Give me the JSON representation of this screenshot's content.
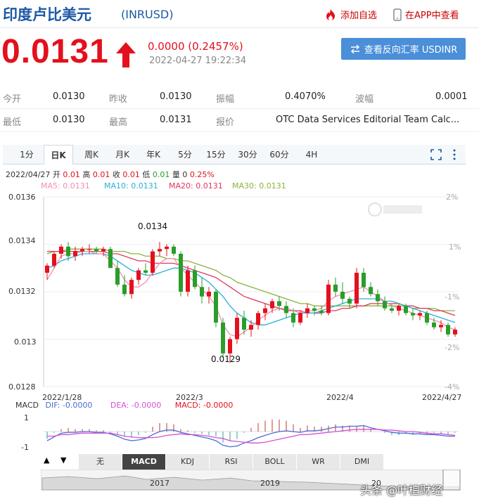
{
  "header": {
    "title": "印度卢比美元",
    "code": "(INRUSD)",
    "add_favorite": "添加自选",
    "view_in_app": "在APP中查看"
  },
  "quote": {
    "price": "0.0131",
    "change": "0.0000 (0.2457%)",
    "timestamp": "2022-04-27  19:22:34",
    "reverse_button": "查看反向汇率 USDINR"
  },
  "stats": {
    "open_label": "今开",
    "open": "0.0130",
    "prev_close_label": "昨收",
    "prev_close": "0.0130",
    "amplitude_label": "振幅",
    "amplitude": "0.4070%",
    "volatility_label": "波幅",
    "volatility": "0.0001",
    "low_label": "最低",
    "low": "0.0130",
    "high_label": "最高",
    "high": "0.0131",
    "quote_label": "报价",
    "quote_source": "OTC Data Services Editorial Team Calc..."
  },
  "periods": [
    "1分",
    "日K",
    "周K",
    "月K",
    "年K",
    "5分",
    "15分",
    "30分",
    "60分",
    "4H"
  ],
  "active_period": "日K",
  "kline_info": {
    "date": "2022/04/27",
    "open_label": "开",
    "open": "0.01",
    "high_label": "高",
    "high": "0.01",
    "close_label": "收",
    "close": "0.01",
    "low_label": "低",
    "low": "0.01",
    "vol_label": "量",
    "vol": "0",
    "pct": "0.25%"
  },
  "ma_legend": {
    "ma5": "MA5: 0.0131",
    "ma10": "MA10: 0.0131",
    "ma20": "MA20: 0.0131",
    "ma30": "MA30: 0.0131"
  },
  "colors": {
    "up": "#e4101d",
    "down": "#2a9d2a",
    "ma5": "#f28fb0",
    "ma10": "#2ab0d8",
    "ma20": "#e0365f",
    "ma30": "#8ab33a",
    "brand": "#1c57a5"
  },
  "price_axis": [
    "0.0136",
    "0.0134",
    "0.0132",
    "0.013",
    "0.0128"
  ],
  "pct_axis": [
    "2%",
    "1%",
    "-1%",
    "-2%",
    "-4%"
  ],
  "date_axis": [
    "2022/1/28",
    "2022/3",
    "2022/4",
    "2022/4/27"
  ],
  "annotations": {
    "high": "0.0134",
    "low": "0.0129"
  },
  "watermark_logo": "sina新浪财经",
  "macd_legend": {
    "title": "MACD",
    "dif": "DIF: -0.0000",
    "dea": "DEA: -0.0000",
    "macd": "MACD: -0.0000"
  },
  "macd_axis": [
    "1",
    "-1"
  ],
  "indicator_tabs": [
    "无",
    "MACD",
    "KDJ",
    "RSI",
    "BOLL",
    "WR",
    "DMI"
  ],
  "active_indicator": "MACD",
  "nav_arrows": {
    "up": "▲",
    "down": "▼"
  },
  "overview_years": [
    "2017",
    "2019",
    "20"
  ],
  "bottom_watermark": "头条 @叶檀财经",
  "chart_data": {
    "type": "candlestick",
    "ylim": [
      0.0128,
      0.0136
    ],
    "candles": [
      [
        0.01328,
        0.01332,
        0.01325,
        0.01331
      ],
      [
        0.01331,
        0.01337,
        0.0133,
        0.01336
      ],
      [
        0.01336,
        0.0134,
        0.01334,
        0.01339
      ],
      [
        0.01339,
        0.01341,
        0.01333,
        0.01335
      ],
      [
        0.01335,
        0.01339,
        0.01333,
        0.01337
      ],
      [
        0.01337,
        0.01339,
        0.01335,
        0.01338
      ],
      [
        0.01338,
        0.0134,
        0.01336,
        0.01338
      ],
      [
        0.01338,
        0.01339,
        0.01336,
        0.01337
      ],
      [
        0.01337,
        0.01339,
        0.01335,
        0.01338
      ],
      [
        0.01338,
        0.01339,
        0.0133,
        0.0133
      ],
      [
        0.0133,
        0.01333,
        0.01322,
        0.01323
      ],
      [
        0.01323,
        0.01327,
        0.01318,
        0.01319
      ],
      [
        0.01319,
        0.01326,
        0.01317,
        0.01325
      ],
      [
        0.01325,
        0.0133,
        0.01323,
        0.01329
      ],
      [
        0.01329,
        0.01332,
        0.01327,
        0.01328
      ],
      [
        0.01328,
        0.01338,
        0.01327,
        0.01337
      ],
      [
        0.01337,
        0.01341,
        0.01335,
        0.01338
      ],
      [
        0.01338,
        0.0134,
        0.01335,
        0.01339
      ],
      [
        0.01339,
        0.0134,
        0.01335,
        0.01336
      ],
      [
        0.01336,
        0.01337,
        0.01318,
        0.0132
      ],
      [
        0.0132,
        0.01331,
        0.01318,
        0.01329
      ],
      [
        0.01329,
        0.01331,
        0.01321,
        0.01322
      ],
      [
        0.01322,
        0.01326,
        0.01315,
        0.01318
      ],
      [
        0.01318,
        0.01322,
        0.01315,
        0.0132
      ],
      [
        0.0132,
        0.01321,
        0.01305,
        0.01307
      ],
      [
        0.01307,
        0.01309,
        0.01292,
        0.01294
      ],
      [
        0.01294,
        0.01301,
        0.0129,
        0.013
      ],
      [
        0.013,
        0.01311,
        0.01298,
        0.01309
      ],
      [
        0.01309,
        0.01312,
        0.01302,
        0.01304
      ],
      [
        0.01304,
        0.01308,
        0.01301,
        0.01306
      ],
      [
        0.01306,
        0.01312,
        0.01304,
        0.01311
      ],
      [
        0.01311,
        0.01315,
        0.01308,
        0.01313
      ],
      [
        0.01313,
        0.01317,
        0.01311,
        0.01316
      ],
      [
        0.01316,
        0.01318,
        0.01312,
        0.01314
      ],
      [
        0.01314,
        0.01316,
        0.01309,
        0.01311
      ],
      [
        0.01311,
        0.01313,
        0.01305,
        0.01307
      ],
      [
        0.01307,
        0.01312,
        0.01306,
        0.01311
      ],
      [
        0.01311,
        0.01315,
        0.01309,
        0.01313
      ],
      [
        0.01313,
        0.01314,
        0.0131,
        0.01312
      ],
      [
        0.01312,
        0.01314,
        0.0131,
        0.01311
      ],
      [
        0.01311,
        0.01325,
        0.0131,
        0.01323
      ],
      [
        0.01323,
        0.01326,
        0.01318,
        0.0132
      ],
      [
        0.0132,
        0.01324,
        0.01315,
        0.01317
      ],
      [
        0.01317,
        0.01318,
        0.01313,
        0.01315
      ],
      [
        0.01315,
        0.0133,
        0.01313,
        0.01328
      ],
      [
        0.01328,
        0.0133,
        0.0132,
        0.01322
      ],
      [
        0.01322,
        0.01324,
        0.01318,
        0.01319
      ],
      [
        0.01319,
        0.01321,
        0.01314,
        0.01316
      ],
      [
        0.01316,
        0.01318,
        0.01312,
        0.01313
      ],
      [
        0.01313,
        0.01315,
        0.01311,
        0.01312
      ],
      [
        0.01312,
        0.01315,
        0.0131,
        0.01314
      ],
      [
        0.01314,
        0.01315,
        0.0131,
        0.01311
      ],
      [
        0.01311,
        0.01313,
        0.01308,
        0.0131
      ],
      [
        0.0131,
        0.01312,
        0.01308,
        0.01311
      ],
      [
        0.01311,
        0.01312,
        0.01306,
        0.01307
      ],
      [
        0.01307,
        0.01309,
        0.01304,
        0.01305
      ],
      [
        0.01305,
        0.01308,
        0.01303,
        0.01306
      ],
      [
        0.01306,
        0.01307,
        0.01301,
        0.01302
      ],
      [
        0.01302,
        0.01305,
        0.01301,
        0.01304
      ]
    ],
    "ma5": [
      0.01325,
      0.0133,
      0.01335,
      0.01336,
      0.01336,
      0.01337,
      0.01337,
      0.01336,
      0.01336,
      0.01333,
      0.0133,
      0.01325,
      0.01322,
      0.01322,
      0.01324,
      0.01328,
      0.01332,
      0.01334,
      0.01334,
      0.0133,
      0.01327,
      0.01324,
      0.01321,
      0.01318,
      0.01314,
      0.01306,
      0.01302,
      0.01301,
      0.01303,
      0.01305,
      0.01308,
      0.0131,
      0.01312,
      0.01313,
      0.01313,
      0.01312,
      0.01311,
      0.01312,
      0.01312,
      0.01313,
      0.01316,
      0.01318,
      0.01319,
      0.0132,
      0.01321,
      0.01322,
      0.0132,
      0.01318,
      0.01316,
      0.01314,
      0.01313,
      0.01312,
      0.01311,
      0.0131,
      0.01309,
      0.01308,
      0.01307,
      0.01305,
      0.01304
    ],
    "ma10": [
      0.0133,
      0.01331,
      0.01333,
      0.01334,
      0.01335,
      0.01336,
      0.01336,
      0.01336,
      0.01336,
      0.01335,
      0.01333,
      0.01331,
      0.01329,
      0.01328,
      0.01327,
      0.01327,
      0.01328,
      0.01329,
      0.0133,
      0.0133,
      0.01329,
      0.01328,
      0.01326,
      0.01324,
      0.01321,
      0.01318,
      0.01314,
      0.01311,
      0.01309,
      0.01307,
      0.01306,
      0.01306,
      0.01307,
      0.01308,
      0.01309,
      0.0131,
      0.01311,
      0.01311,
      0.01311,
      0.01312,
      0.01313,
      0.01314,
      0.01315,
      0.01316,
      0.01317,
      0.01317,
      0.01317,
      0.01317,
      0.01316,
      0.01316,
      0.01315,
      0.01314,
      0.01313,
      0.01312,
      0.01311,
      0.0131,
      0.01309,
      0.01308,
      0.01307
    ],
    "ma20": [
      0.01337,
      0.01337,
      0.01337,
      0.01337,
      0.01337,
      0.01337,
      0.01337,
      0.01337,
      0.01337,
      0.01336,
      0.01336,
      0.01335,
      0.01334,
      0.01333,
      0.01333,
      0.01332,
      0.01332,
      0.01332,
      0.01332,
      0.01331,
      0.0133,
      0.01329,
      0.01328,
      0.01327,
      0.01326,
      0.01324,
      0.01322,
      0.0132,
      0.01318,
      0.01317,
      0.01316,
      0.01315,
      0.01314,
      0.01313,
      0.01312,
      0.01312,
      0.01312,
      0.01311,
      0.01311,
      0.01311,
      0.01312,
      0.01312,
      0.01313,
      0.01313,
      0.01314,
      0.01314,
      0.01315,
      0.01315,
      0.01315,
      0.01315,
      0.01315,
      0.01314,
      0.01314,
      0.01313,
      0.01313,
      0.01312,
      0.01312,
      0.01311,
      0.0131
    ],
    "ma30": [
      0.01336,
      0.01337,
      0.01337,
      0.01338,
      0.01338,
      0.01338,
      0.01338,
      0.01338,
      0.01338,
      0.01337,
      0.01337,
      0.01337,
      0.01336,
      0.01336,
      0.01335,
      0.01335,
      0.01335,
      0.01334,
      0.01334,
      0.01333,
      0.01333,
      0.01332,
      0.01331,
      0.0133,
      0.01329,
      0.01327,
      0.01326,
      0.01324,
      0.01323,
      0.01322,
      0.01321,
      0.0132,
      0.01319,
      0.01318,
      0.01317,
      0.01316,
      0.01315,
      0.01315,
      0.01314,
      0.01314,
      0.01314,
      0.01314,
      0.01314,
      0.01314,
      0.01314,
      0.01314,
      0.01314,
      0.01314,
      0.01314,
      0.01314,
      0.01314,
      0.01314,
      0.01313,
      0.01313,
      0.01313,
      0.01313,
      0.01312,
      0.01312,
      0.01312
    ]
  }
}
